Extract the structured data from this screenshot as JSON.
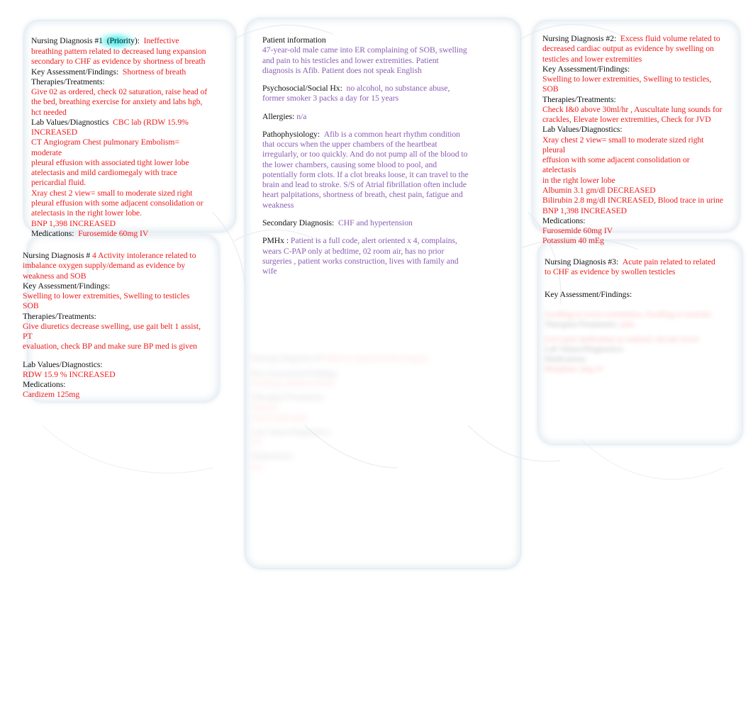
{
  "document": {
    "title": "Nursing Care Plan Concept Map",
    "colors": {
      "label": "#121212",
      "content_red": "#f01c1c",
      "content_purple": "#8a5fb5",
      "box_border": "#e3e9ee",
      "priority_highlight": "#00e2e2"
    }
  },
  "diagnosis_1": {
    "header_label": "Nursing Diagnosis #1",
    "priority_tag": "(Priority):",
    "header_value": "Ineffective",
    "header_cont": [
      "breathing pattern related to decreased lung expansion",
      "secondary to CHF as evidence by shortness of breath"
    ],
    "key_assessment_label": "Key Assessment/Findings:",
    "key_assessment_value": "Shortness of breath",
    "therapies_label": "Therapies/Treatments:",
    "therapies_value": [
      "Give 02 as ordered, check 02 saturation, raise head of",
      "the bed, breathing exercise for anxiety and labs hgb,",
      "hct needed"
    ],
    "labs_label": "Lab Values/Diagnostics",
    "labs_value_inline": "CBC lab (RDW 15.9%",
    "labs_value_lines": [
      "INCREASED",
      "CT Angiogram Chest pulmonary Embolism= moderate",
      "pleural effusion with associated tight lower lobe",
      "atelectasis and mild cardiomegaly with trace",
      "pericardial fluid.",
      "Xray chest 2 view= small to moderate sized right",
      "pleural effusion with some adjacent consolidation or",
      "atelectasis in the right lower lobe.",
      "BNP 1,398 INCREASED"
    ],
    "medications_label": "Medications:",
    "medications_value": "Furosemide 60mg IV"
  },
  "diagnosis_4": {
    "header_label": "Nursing Diagnosis #",
    "header_value": "4 Activity intolerance related to",
    "header_cont": [
      "imbalance oxygen supply/demand as evidence by",
      "weakness and SOB"
    ],
    "key_assessment_label": "Key Assessment/Findings:",
    "key_assessment_value": [
      "Swelling to lower extremities, Swelling to testicles",
      "SOB"
    ],
    "therapies_label": "Therapies/Treatments:",
    "therapies_value": [
      "Give diuretics decrease swelling, use gait belt 1 assist, PT",
      "evaluation, check BP and make sure BP med is given"
    ],
    "labs_label": "Lab Values/Diagnostics:",
    "labs_value": "RDW 15.9 % INCREASED",
    "medications_label": "Medications:",
    "medications_value": "Cardizem 125mg"
  },
  "patient": {
    "section_title": "Patient information",
    "summary": [
      "47-year-old male came into ER complaining of SOB, swelling",
      "and pain to his testicles and lower extremities. Patient",
      "diagnosis is Afib.   Patient does not speak English"
    ],
    "psychosocial_label": "Psychosocial/Social Hx:",
    "psychosocial_value": "no alcohol, no substance abuse,",
    "psychosocial_cont": "former smoker 3 packs a day for 15 years",
    "allergies_label": "Allergies:",
    "allergies_value": "n/a",
    "patho_label": "Pathophysiology:",
    "patho_value": "Afib is a common heart rhythm condition",
    "patho_cont": [
      "that occurs when the upper chambers of the heartbeat",
      "irregularly, or too quickly. And do not pump all of the blood to",
      "the lower chambers, causing some blood to pool, and",
      "potentially form clots. If a clot breaks loose, it can travel to the",
      "brain and lead to stroke. S/S of Atrial fibrillation often include",
      "heart palpitations, shortness of breath, chest pain, fatigue and",
      "weakness"
    ],
    "secondary_label": "Secondary Diagnosis:",
    "secondary_value": "CHF and hypertension",
    "pmhx_label": "PMHx :",
    "pmhx_value": "Patient is a full code, alert oriented x 4, complains,",
    "pmhx_cont": [
      "wears C-PAP only at bedtime, 02 room air, has no prior",
      "surgeries , patient works construction, lives with family and",
      "wife"
    ]
  },
  "diagnosis_2": {
    "header_label": "Nursing Diagnosis #2:",
    "header_value": "Excess fluid volume related to",
    "header_cont": [
      "decreased cardiac output as evidence by swelling on",
      "testicles and lower extremities"
    ],
    "key_assessment_label": "Key Assessment/Findings:",
    "key_assessment_value": "Swelling to lower extremities, Swelling to testicles, SOB",
    "therapies_label": "Therapies/Treatments:",
    "therapies_value": [
      "Check I&0 above 30ml/hr , Auscultate lung sounds for",
      "crackles, Elevate lower extremities, Check for JVD"
    ],
    "labs_label": "Lab Values/Diagnostics:",
    "labs_value": [
      "Xray chest 2 view= small to moderate sized right pleural",
      "effusion with some adjacent consolidation or atelectasis",
      "in the right lower lobe",
      "Albumin 3.1 gm/dl DECREASED",
      "Bilirubin 2.8 mg/dl INCREASED, Blood trace in urine",
      "BNP 1,398 INCREASED"
    ],
    "medications_label": "Medications:",
    "medications_value": [
      "Furosemide 60mg IV",
      "Potassium 40 mEg"
    ]
  },
  "diagnosis_3": {
    "header_label": "Nursing Diagnosis #3:",
    "header_value": "Acute pain related to related",
    "header_cont": "to CHF as evidence by swollen testicles",
    "key_assessment_label": "Key Assessment/Findings:",
    "illegible_note": ""
  }
}
